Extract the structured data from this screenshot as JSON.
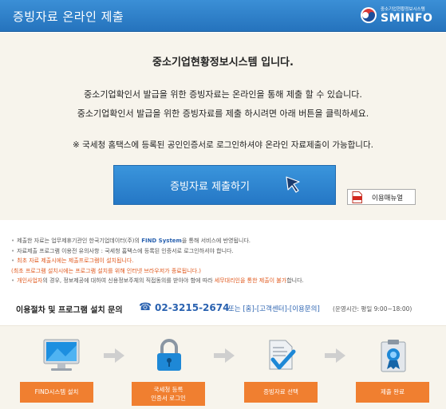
{
  "header": {
    "title": "증빙자료 온라인 제출",
    "logo_sub": "중소기업현황정보시스템",
    "logo_main": "SMINFO"
  },
  "intro": {
    "title": "중소기업현황정보시스템 입니다.",
    "line1": "중소기업확인서 발급을 위한 증빙자료는 온라인을 통해 제출 할 수 있습니다.",
    "line2": "중소기업확인서 발급을 위한 증빙자료를 제출 하시려면 아래 버튼을 클릭하세요.",
    "notice": "※ 국세청 홈택스에 등록된 공인인증서로 로그인하셔야 온라인 자료제출이 가능합니다."
  },
  "buttons": {
    "submit": "증빙자료 제출하기",
    "manual": "이용매뉴얼"
  },
  "notes": {
    "n1_a": "제출한 자료는 업무제휴기관인 한국기업데이터(주)의 ",
    "n1_b": "FIND System",
    "n1_c": "을 통해 서비스에 반영됩니다.",
    "n2": "자료제출 프로그램 이용전 유의사항 : 국세청 홈택스에 등록된 인증서로 로그인하셔야 합니다.",
    "n3": "최초 자료 제출시에는 제출프로그램이 설치됩니다.",
    "n4": "(최초 프로그램 설치시에는 프로그램 설치를 위해 인터넷 브라우저가 종료됩니다.)",
    "n5_a": "개인사업자",
    "n5_b": "의 경우, 정보제공에 대하여 신용정보주체의 직접동의를 받아야 함에 따라 ",
    "n5_c": "세무대리인을 통한 제출이 불가",
    "n5_d": "합니다."
  },
  "contact": {
    "label": "이용절차 및 프로그램 설치 문의",
    "phone_icon": "☎",
    "phone": "02-3215-2674",
    "suffix": "또는 [홈]-[고객센터]-[이용문의]",
    "hours": "(운영시간: 평일 9:00~18:00)"
  },
  "steps": [
    {
      "label": "FIND시스템 설치",
      "icon": "monitor-icon"
    },
    {
      "label": "국세청 등록\n인증서 로그인",
      "icon": "lock-icon"
    },
    {
      "label": "증빙자료 선택",
      "icon": "document-check-icon"
    },
    {
      "label": "제출 완료",
      "icon": "clipboard-badge-icon"
    }
  ],
  "colors": {
    "header_blue": "#2f82cc",
    "button_blue": "#2f86d0",
    "step_orange": "#f07f30",
    "note_orange": "#e0591e",
    "link_blue": "#2a62b0",
    "panel_bg": "#f7f4ec"
  }
}
